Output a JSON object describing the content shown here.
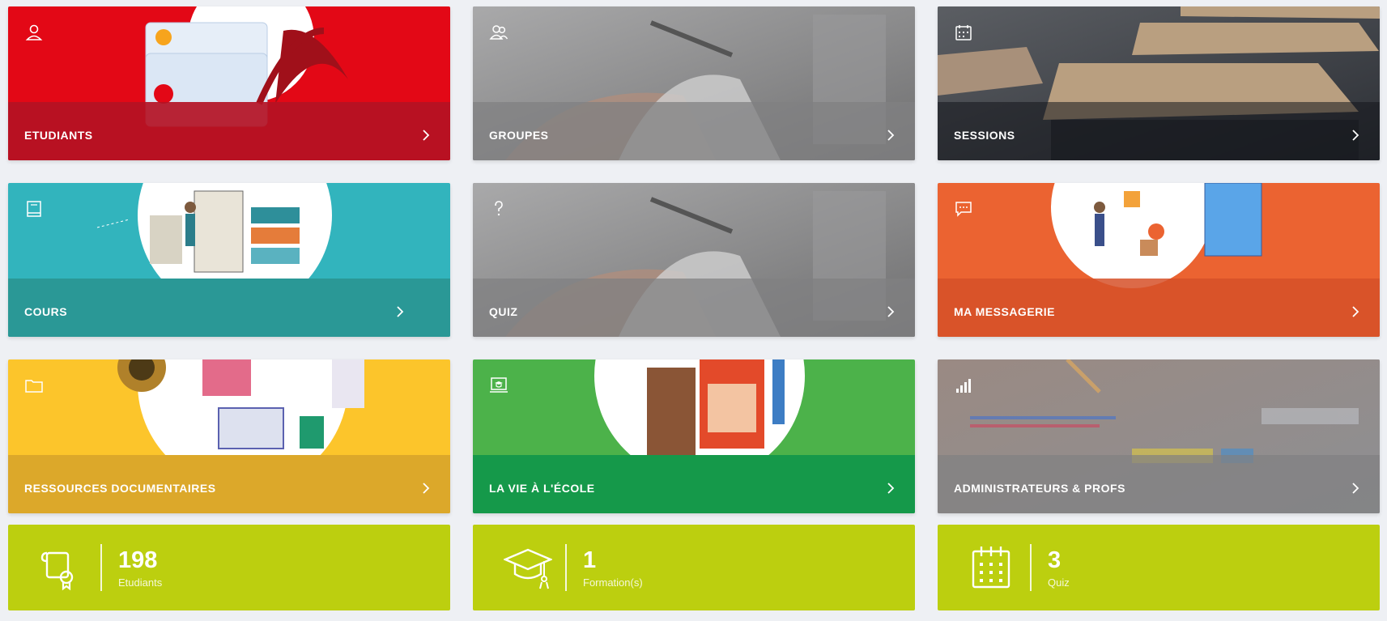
{
  "colors": {
    "page_bg": "#eef0f4",
    "stats_bg": "#bccf0f",
    "etudiants": "#e30816",
    "cours": "#32b4bd",
    "messagerie": "#eb6331",
    "ressources": "#fcc52b",
    "vie_ecole": "#4cb24a",
    "photo_grey": "#8b8b8c"
  },
  "tiles": [
    {
      "label": "ETUDIANTS",
      "icon": "user-icon"
    },
    {
      "label": "GROUPES",
      "icon": "users-icon"
    },
    {
      "label": "SESSIONS",
      "icon": "calendar-icon"
    },
    {
      "label": "COURS",
      "icon": "book-icon"
    },
    {
      "label": "QUIZ",
      "icon": "question-icon"
    },
    {
      "label": "MA MESSAGERIE",
      "icon": "chat-icon"
    },
    {
      "label": "RESSOURCES DOCUMENTAIRES",
      "icon": "folder-icon"
    },
    {
      "label": "LA VIE À L'ÉCOLE",
      "icon": "laptop-graduation-icon"
    },
    {
      "label": "ADMINISTRATEURS & PROFS",
      "icon": "bar-chart-icon"
    }
  ],
  "stats": [
    {
      "value": "198",
      "caption": "Etudiants",
      "icon": "diploma-icon"
    },
    {
      "value": "1",
      "caption": "Formation(s)",
      "icon": "graduation-cap-icon"
    },
    {
      "value": "3",
      "caption": "Quiz",
      "icon": "calendar-grid-icon"
    }
  ]
}
